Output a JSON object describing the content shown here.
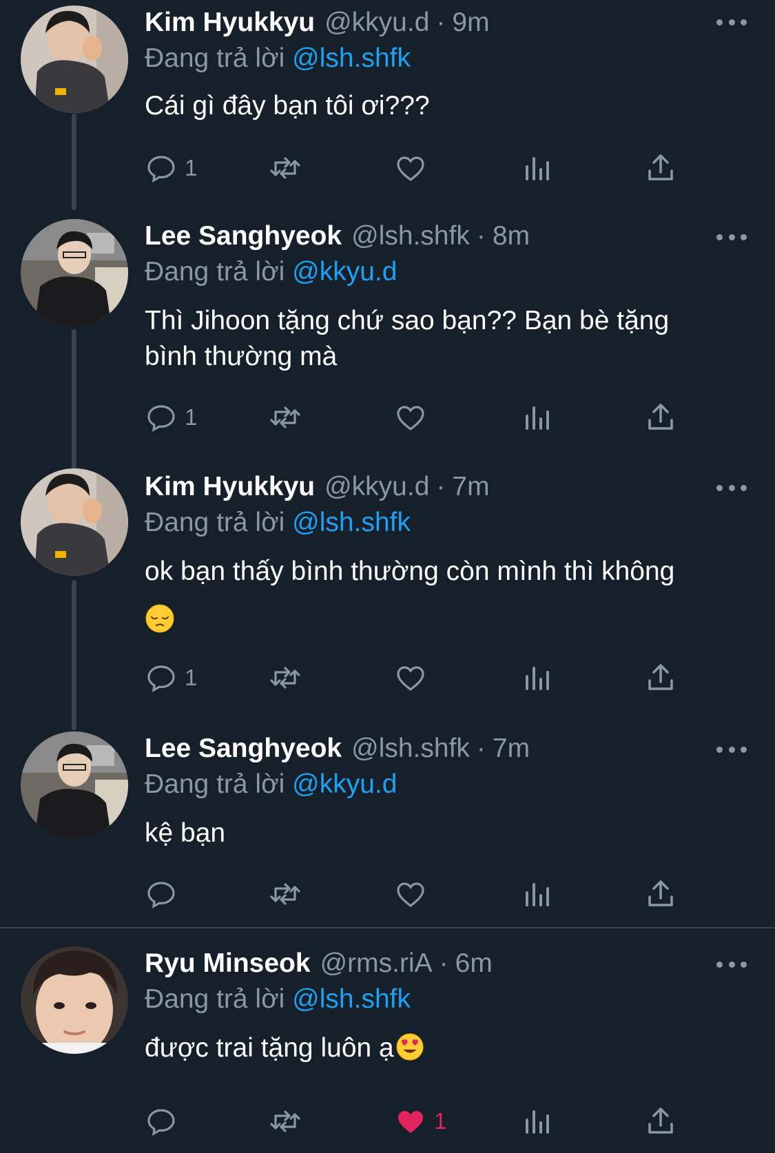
{
  "colors": {
    "background": "#15202b",
    "secondary_text": "#8899a6",
    "link": "#1da1f2",
    "like": "#e0245e",
    "divider": "#38444d"
  },
  "reply_prefix": "Đang trả lời",
  "tweets": [
    {
      "name": "Kim Hyukkyu",
      "handle": "@kkyu.d",
      "sep": "·",
      "time": "9m",
      "reply_to": "@lsh.shfk",
      "text_lines": [
        "Cái gì đây bạn tôi ơi???"
      ],
      "reply_count": "1",
      "like_count": "",
      "liked": false
    },
    {
      "name": "Lee Sanghyeok",
      "handle": "@lsh.shfk",
      "sep": "·",
      "time": "8m",
      "reply_to": "@kkyu.d",
      "text_lines": [
        "Thì Jihoon tặng chứ sao bạn?? Bạn bè tặng",
        "bình thường mà"
      ],
      "reply_count": "1",
      "like_count": "",
      "liked": false
    },
    {
      "name": "Kim Hyukkyu",
      "handle": "@kkyu.d",
      "sep": "·",
      "time": "7m",
      "reply_to": "@lsh.shfk",
      "text_lines": [
        "ok bạn thấy bình thường còn mình thì không"
      ],
      "emoji": "pensive-face-emoji",
      "reply_count": "1",
      "like_count": "",
      "liked": false
    },
    {
      "name": "Lee Sanghyeok",
      "handle": "@lsh.shfk",
      "sep": "·",
      "time": "7m",
      "reply_to": "@kkyu.d",
      "text_lines": [
        "kệ bạn"
      ],
      "reply_count": "",
      "like_count": "",
      "liked": false
    },
    {
      "name": "Ryu Minseok",
      "handle": "@rms.riA",
      "sep": "·",
      "time": "6m",
      "reply_to": "@lsh.shfk",
      "text_lines": [
        "được trai tặng luôn ạ"
      ],
      "emoji": "heart-eyes-emoji",
      "reply_count": "",
      "like_count": "1",
      "liked": true
    }
  ]
}
